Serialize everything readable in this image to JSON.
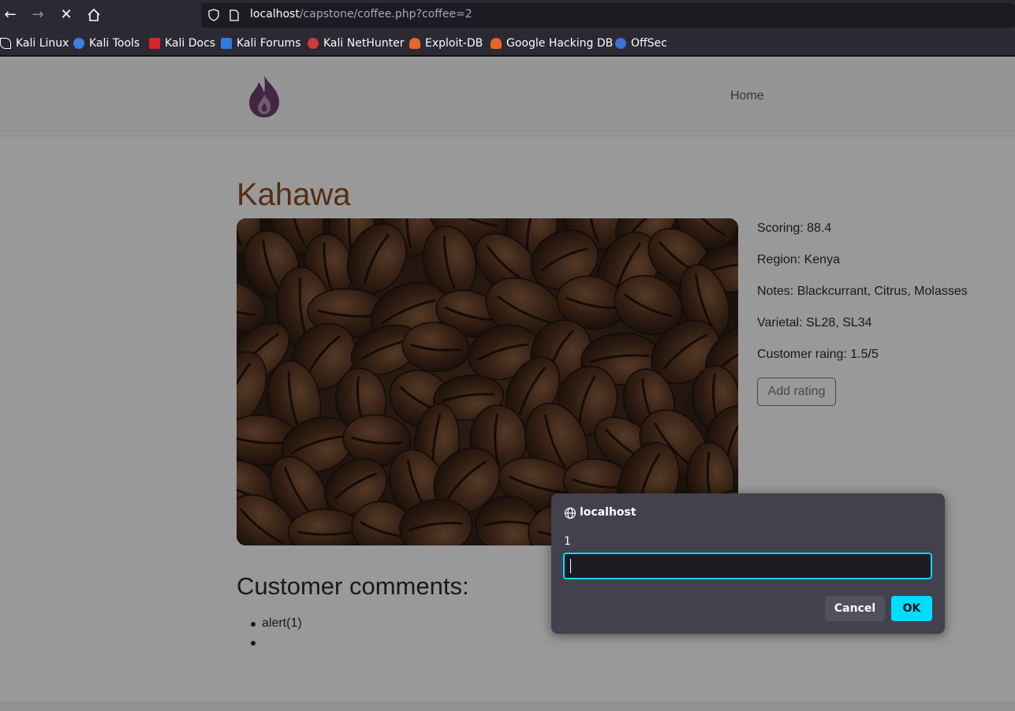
{
  "browser": {
    "url_host": "localhost",
    "url_path": "/capstone/coffee.php?coffee=2",
    "bookmarks": [
      {
        "label": "Kali Linux",
        "icon": "kali-dragon-icon"
      },
      {
        "label": "Kali Tools",
        "icon": "kali-tools-icon"
      },
      {
        "label": "Kali Docs",
        "icon": "kali-docs-icon"
      },
      {
        "label": "Kali Forums",
        "icon": "kali-forums-icon"
      },
      {
        "label": "Kali NetHunter",
        "icon": "nethunter-icon"
      },
      {
        "label": "Exploit-DB",
        "icon": "exploit-db-icon"
      },
      {
        "label": "Google Hacking DB",
        "icon": "ghdb-icon"
      },
      {
        "label": "OffSec",
        "icon": "offsec-icon"
      }
    ]
  },
  "site": {
    "nav_home": "Home"
  },
  "coffee": {
    "name": "Kahawa",
    "scoring": "Scoring: 88.4",
    "region": "Region: Kenya",
    "notes": "Notes: Blackcurrant, Citrus, Molasses",
    "varietal": "Varietal: SL28, SL34",
    "rating": "Customer raing: 1.5/5",
    "add_rating_label": "Add rating"
  },
  "comments": {
    "title": "Customer comments:",
    "items": [
      "alert(1)",
      ""
    ]
  },
  "dialog": {
    "origin": "localhost",
    "message": "1",
    "input_value": "",
    "cancel_label": "Cancel",
    "ok_label": "OK"
  },
  "colors": {
    "accent": "#00ddff",
    "title_brown": "#8b4513"
  }
}
